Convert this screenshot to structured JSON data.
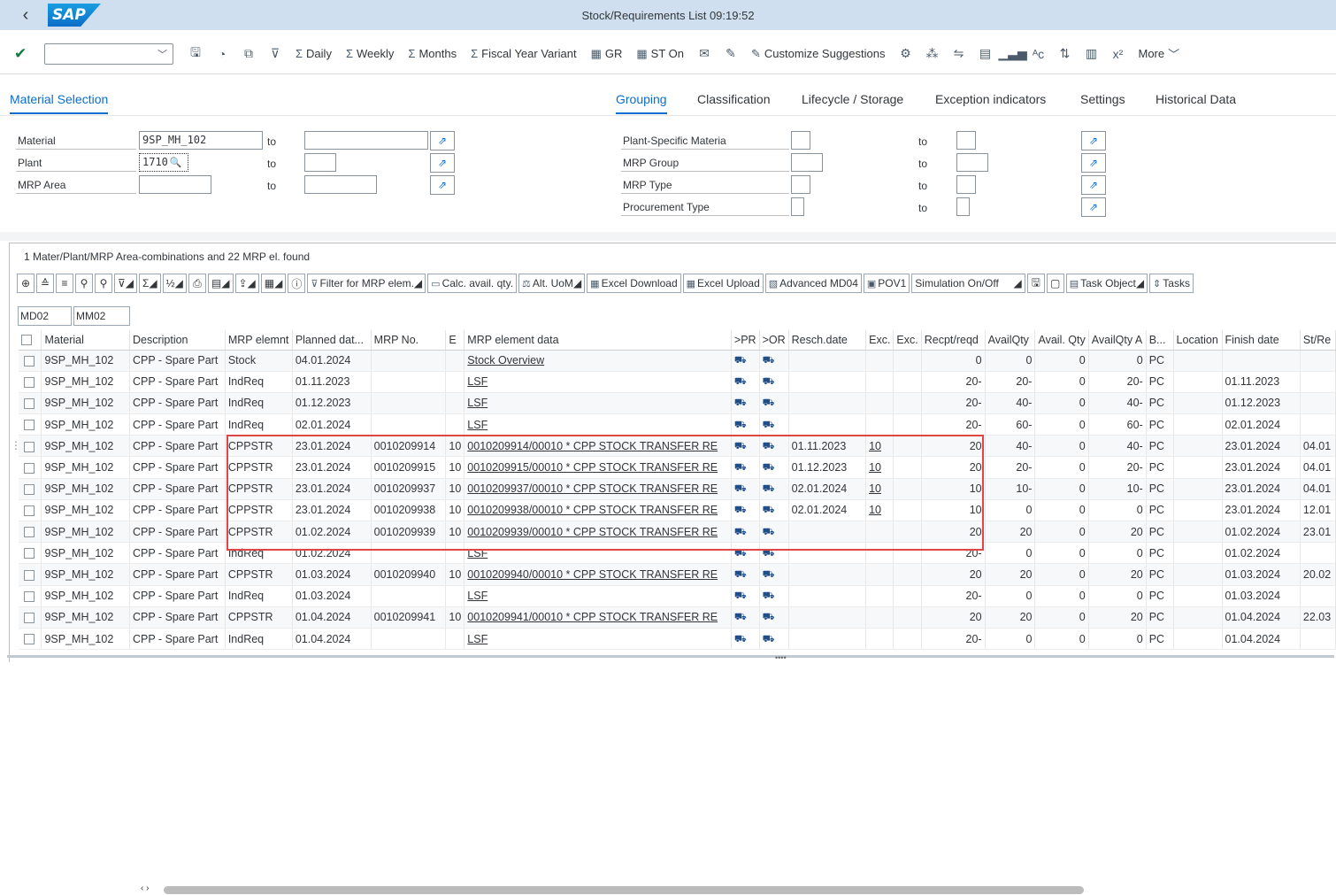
{
  "shell": {
    "title": "Stock/Requirements List 09:19:52",
    "logo_text": "SAP"
  },
  "toolbar": {
    "select_value": "",
    "buttons": [
      {
        "icon": "sigma-icon",
        "glyph": "Σ",
        "label": "Daily"
      },
      {
        "icon": "sigma-icon",
        "glyph": "Σ",
        "label": "Weekly"
      },
      {
        "icon": "sigma-icon",
        "glyph": "Σ",
        "label": "Months"
      },
      {
        "icon": "sigma-icon",
        "glyph": "Σ",
        "label": "Fiscal Year Variant"
      },
      {
        "icon": "calendar-icon",
        "glyph": "▦",
        "label": "GR"
      },
      {
        "icon": "calendar-icon",
        "glyph": "▦",
        "label": "ST On"
      }
    ],
    "customize": "Customize Suggestions",
    "more": "More"
  },
  "tabs": {
    "left": "Material Selection",
    "right": [
      "Grouping",
      "Classification",
      "Lifecycle / Storage",
      "Exception indicators",
      "Settings",
      "Historical Data"
    ]
  },
  "form_left": [
    {
      "label": "Material",
      "value": "9SP_MH_102",
      "to": "to",
      "to_value": ""
    },
    {
      "label": "Plant",
      "value": "1710",
      "to": "to",
      "to_value": ""
    },
    {
      "label": "MRP Area",
      "value": "",
      "to": "to",
      "to_value": ""
    }
  ],
  "form_right": [
    {
      "label": "Plant-Specific Materia",
      "to": "to"
    },
    {
      "label": "MRP Group",
      "to": "to"
    },
    {
      "label": "MRP Type",
      "to": "to"
    },
    {
      "label": "Procurement Type",
      "to": "to"
    }
  ],
  "alv": {
    "title": "1 Mater/Plant/MRP Area-combinations and 22 MRP el. found",
    "toolbar_labels": [
      "Filter for MRP elem.",
      "Calc. avail. qty.",
      "Alt. UoM",
      "Excel Download",
      "Excel Upload",
      "Advanced MD04",
      "POV1",
      "Simulation On/Off",
      "Task Object",
      "Tasks"
    ],
    "tcodes": [
      "MD02",
      "MM02"
    ],
    "columns": [
      "Material",
      "Description",
      "MRP elemnt",
      "Planned dat...",
      "MRP No.",
      "E",
      "MRP element data",
      ">PR",
      ">OR",
      "Resch.date",
      "Exc.",
      "Exc.",
      "Recpt/reqd",
      "AvailQty",
      "Avail. Qty",
      "AvailQty A",
      "B...",
      "Location",
      "Finish date",
      "St/Re"
    ],
    "rows": [
      [
        "9SP_MH_102",
        "CPP - Spare Part",
        "Stock",
        "04.01.2024",
        "",
        "",
        "Stock Overview",
        "",
        "",
        "",
        "",
        "",
        "0",
        "0",
        "0",
        "0",
        "PC",
        "",
        "",
        ""
      ],
      [
        "9SP_MH_102",
        "CPP - Spare Part",
        "IndReq",
        "01.11.2023",
        "",
        "",
        "LSF",
        "",
        "",
        "",
        "",
        "",
        "20-",
        "20-",
        "0",
        "20-",
        "PC",
        "",
        "01.11.2023",
        ""
      ],
      [
        "9SP_MH_102",
        "CPP - Spare Part",
        "IndReq",
        "01.12.2023",
        "",
        "",
        "LSF",
        "",
        "",
        "",
        "",
        "",
        "20-",
        "40-",
        "0",
        "40-",
        "PC",
        "",
        "01.12.2023",
        ""
      ],
      [
        "9SP_MH_102",
        "CPP - Spare Part",
        "IndReq",
        "02.01.2024",
        "",
        "",
        "LSF",
        "",
        "",
        "",
        "",
        "",
        "20-",
        "60-",
        "0",
        "60-",
        "PC",
        "",
        "02.01.2024",
        ""
      ],
      [
        "9SP_MH_102",
        "CPP - Spare Part",
        "CPPSTR",
        "23.01.2024",
        "0010209914",
        "10",
        "0010209914/00010 * CPP STOCK TRANSFER RE",
        "",
        "",
        "01.11.2023",
        "10",
        "",
        "20",
        "40-",
        "0",
        "40-",
        "PC",
        "",
        "23.01.2024",
        "04.01"
      ],
      [
        "9SP_MH_102",
        "CPP - Spare Part",
        "CPPSTR",
        "23.01.2024",
        "0010209915",
        "10",
        "0010209915/00010 * CPP STOCK TRANSFER RE",
        "",
        "",
        "01.12.2023",
        "10",
        "",
        "20",
        "20-",
        "0",
        "20-",
        "PC",
        "",
        "23.01.2024",
        "04.01"
      ],
      [
        "9SP_MH_102",
        "CPP - Spare Part",
        "CPPSTR",
        "23.01.2024",
        "0010209937",
        "10",
        "0010209937/00010 * CPP STOCK TRANSFER RE",
        "",
        "",
        "02.01.2024",
        "10",
        "",
        "10",
        "10-",
        "0",
        "10-",
        "PC",
        "",
        "23.01.2024",
        "04.01"
      ],
      [
        "9SP_MH_102",
        "CPP - Spare Part",
        "CPPSTR",
        "23.01.2024",
        "0010209938",
        "10",
        "0010209938/00010 * CPP STOCK TRANSFER RE",
        "",
        "",
        "02.01.2024",
        "10",
        "",
        "10",
        "0",
        "0",
        "0",
        "PC",
        "",
        "23.01.2024",
        "12.01"
      ],
      [
        "9SP_MH_102",
        "CPP - Spare Part",
        "CPPSTR",
        "01.02.2024",
        "0010209939",
        "10",
        "0010209939/00010 * CPP STOCK TRANSFER RE",
        "",
        "",
        "",
        "",
        "",
        "20",
        "20",
        "0",
        "20",
        "PC",
        "",
        "01.02.2024",
        "23.01"
      ],
      [
        "9SP_MH_102",
        "CPP - Spare Part",
        "IndReq",
        "01.02.2024",
        "",
        "",
        "LSF",
        "",
        "",
        "",
        "",
        "",
        "20-",
        "0",
        "0",
        "0",
        "PC",
        "",
        "01.02.2024",
        ""
      ],
      [
        "9SP_MH_102",
        "CPP - Spare Part",
        "CPPSTR",
        "01.03.2024",
        "0010209940",
        "10",
        "0010209940/00010 * CPP STOCK TRANSFER RE",
        "",
        "",
        "",
        "",
        "",
        "20",
        "20",
        "0",
        "20",
        "PC",
        "",
        "01.03.2024",
        "20.02"
      ],
      [
        "9SP_MH_102",
        "CPP - Spare Part",
        "IndReq",
        "01.03.2024",
        "",
        "",
        "LSF",
        "",
        "",
        "",
        "",
        "",
        "20-",
        "0",
        "0",
        "0",
        "PC",
        "",
        "01.03.2024",
        ""
      ],
      [
        "9SP_MH_102",
        "CPP - Spare Part",
        "CPPSTR",
        "01.04.2024",
        "0010209941",
        "10",
        "0010209941/00010 * CPP STOCK TRANSFER RE",
        "",
        "",
        "",
        "",
        "",
        "20",
        "20",
        "0",
        "20",
        "PC",
        "",
        "01.04.2024",
        "22.03"
      ],
      [
        "9SP_MH_102",
        "CPP - Spare Part",
        "IndReq",
        "01.04.2024",
        "",
        "",
        "LSF",
        "",
        "",
        "",
        "",
        "",
        "20-",
        "0",
        "0",
        "0",
        "PC",
        "",
        "01.04.2024",
        ""
      ]
    ]
  }
}
